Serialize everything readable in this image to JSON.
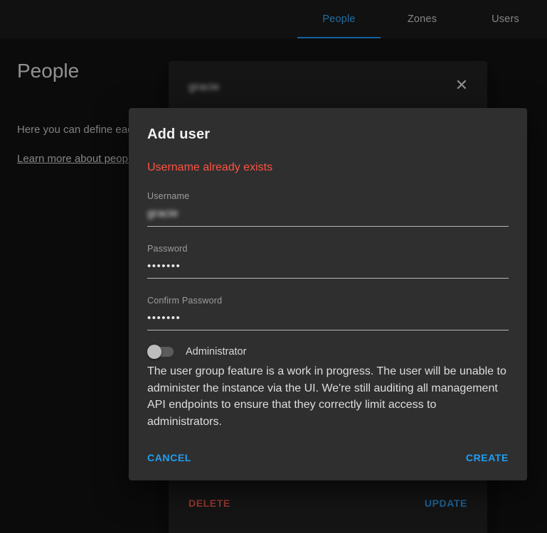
{
  "topbar": {
    "tabs": [
      {
        "label": "People",
        "active": true
      },
      {
        "label": "Zones",
        "active": false
      },
      {
        "label": "Users",
        "active": false
      }
    ]
  },
  "page": {
    "title": "People",
    "description": "Here you can define each person of interest in Home Assistant.",
    "link": "Learn more about people"
  },
  "background_dialog": {
    "person_name": "gracie",
    "close_icon": "✕",
    "delete_label": "DELETE",
    "update_label": "UPDATE"
  },
  "dialog": {
    "title": "Add user",
    "error": "Username already exists",
    "fields": [
      {
        "label": "Username",
        "value": "gracie"
      },
      {
        "label": "Password",
        "value": "•••••••"
      },
      {
        "label": "Confirm Password",
        "value": "•••••••"
      }
    ],
    "admin_toggle_label": "Administrator",
    "admin_note": "The user group feature is a work in progress. The user will be unable to administer the instance via the UI. We're still auditing all management API endpoints to ensure that they correctly limit access to administrators.",
    "cancel_label": "CANCEL",
    "create_label": "CREATE"
  },
  "colors": {
    "accent": "#2196f3",
    "error": "#ff5242",
    "delete": "#f1574b"
  }
}
